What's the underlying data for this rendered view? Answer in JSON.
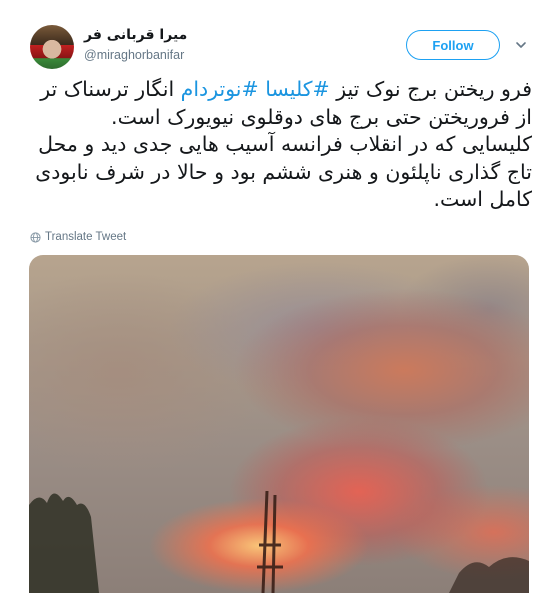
{
  "user": {
    "display_name": "میرا قربانی فر",
    "handle": "@miraghorbanifar"
  },
  "follow_button_label": "Follow",
  "tweet": {
    "line1_pre": "فرو ریختن برج نوک تیز ",
    "hashtag1": "#کلیسا",
    "hashtag2": "#نوتردام",
    "line1_post": " انگار ترسناک تر از فروریختن حتی برج های دوقلوی نیویورک است.",
    "paragraph2": "کلیسایی که در انقلاب فرانسه آسیب هایی جدی دید و محل تاج گذاری ناپلئون و هنری ششم بود و حالا در شرف نابودی کامل است."
  },
  "translate_label": "Translate Tweet",
  "colors": {
    "accent": "#1da1f2",
    "hashtag": "#1b95e0",
    "secondary_text": "#657786",
    "text": "#14171a"
  },
  "icons": {
    "more": "chevron-down-icon",
    "translate": "globe-icon"
  }
}
